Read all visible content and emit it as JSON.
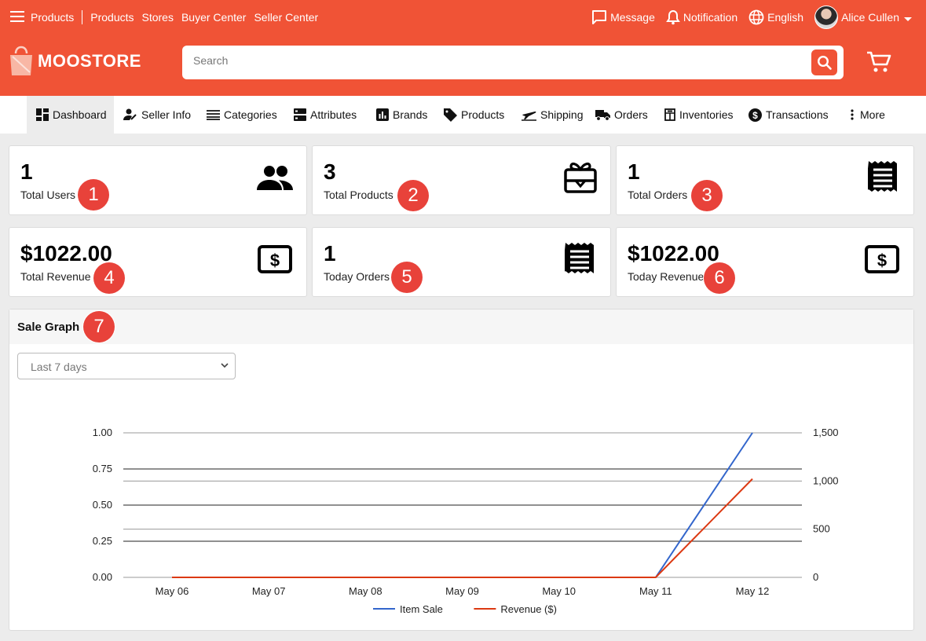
{
  "topbar": {
    "links": [
      "Products",
      "Products",
      "Stores",
      "Buyer Center",
      "Seller Center"
    ],
    "message": "Message",
    "notification": "Notification",
    "language": "English",
    "user": "Alice Cullen"
  },
  "brand": {
    "name": "MOOSTORE",
    "color": "#f05336"
  },
  "search": {
    "placeholder": "Search",
    "value": ""
  },
  "nav": [
    {
      "label": "Dashboard",
      "icon": "dashboard-icon"
    },
    {
      "label": "Seller Info",
      "icon": "seller-icon"
    },
    {
      "label": "Categories",
      "icon": "list-icon"
    },
    {
      "label": "Attributes",
      "icon": "attributes-icon"
    },
    {
      "label": "Brands",
      "icon": "chart-box-icon"
    },
    {
      "label": "Products",
      "icon": "tag-icon"
    },
    {
      "label": "Shipping",
      "icon": "airplane-icon"
    },
    {
      "label": "Orders",
      "icon": "truck-icon"
    },
    {
      "label": "Inventories",
      "icon": "inventory-icon"
    },
    {
      "label": "Transactions",
      "icon": "dollar-circle-icon"
    },
    {
      "label": "More",
      "icon": "more-vertical-icon"
    }
  ],
  "stats": [
    {
      "value": "1",
      "label": "Total Users",
      "icon": "users-icon",
      "badge": "1"
    },
    {
      "value": "3",
      "label": "Total Products",
      "icon": "gift-box-icon",
      "badge": "2"
    },
    {
      "value": "1",
      "label": "Total Orders",
      "icon": "receipt-icon",
      "badge": "3"
    },
    {
      "value": "$1022.00",
      "label": "Total Revenue",
      "icon": "money-icon",
      "badge": "4"
    },
    {
      "value": "1",
      "label": "Today Orders",
      "icon": "receipt-icon",
      "badge": "5"
    },
    {
      "value": "$1022.00",
      "label": "Today Revenue",
      "icon": "money-icon",
      "badge": "6"
    }
  ],
  "graph": {
    "title": "Sale Graph",
    "badge": "7",
    "range_selected": "Last 7 days"
  },
  "chart_data": {
    "type": "line",
    "title": "",
    "x": [
      "May 06",
      "May 07",
      "May 08",
      "May 09",
      "May 10",
      "May 11",
      "May 12"
    ],
    "series": [
      {
        "name": "Item Sale",
        "axis": "left",
        "color": "#3366cc",
        "values": [
          0,
          0,
          0,
          0,
          0,
          0,
          1
        ]
      },
      {
        "name": "Revenue ($)",
        "axis": "right",
        "color": "#dc3912",
        "values": [
          0,
          0,
          0,
          0,
          0,
          0,
          1022
        ]
      }
    ],
    "y_left": {
      "range": [
        0,
        1
      ],
      "ticks": [
        "0.00",
        "0.25",
        "0.50",
        "0.75",
        "1.00"
      ]
    },
    "y_right": {
      "range": [
        0,
        1500
      ],
      "ticks": [
        "0",
        "500",
        "1,000",
        "1,500"
      ]
    },
    "grid": true,
    "legend": "bottom"
  }
}
